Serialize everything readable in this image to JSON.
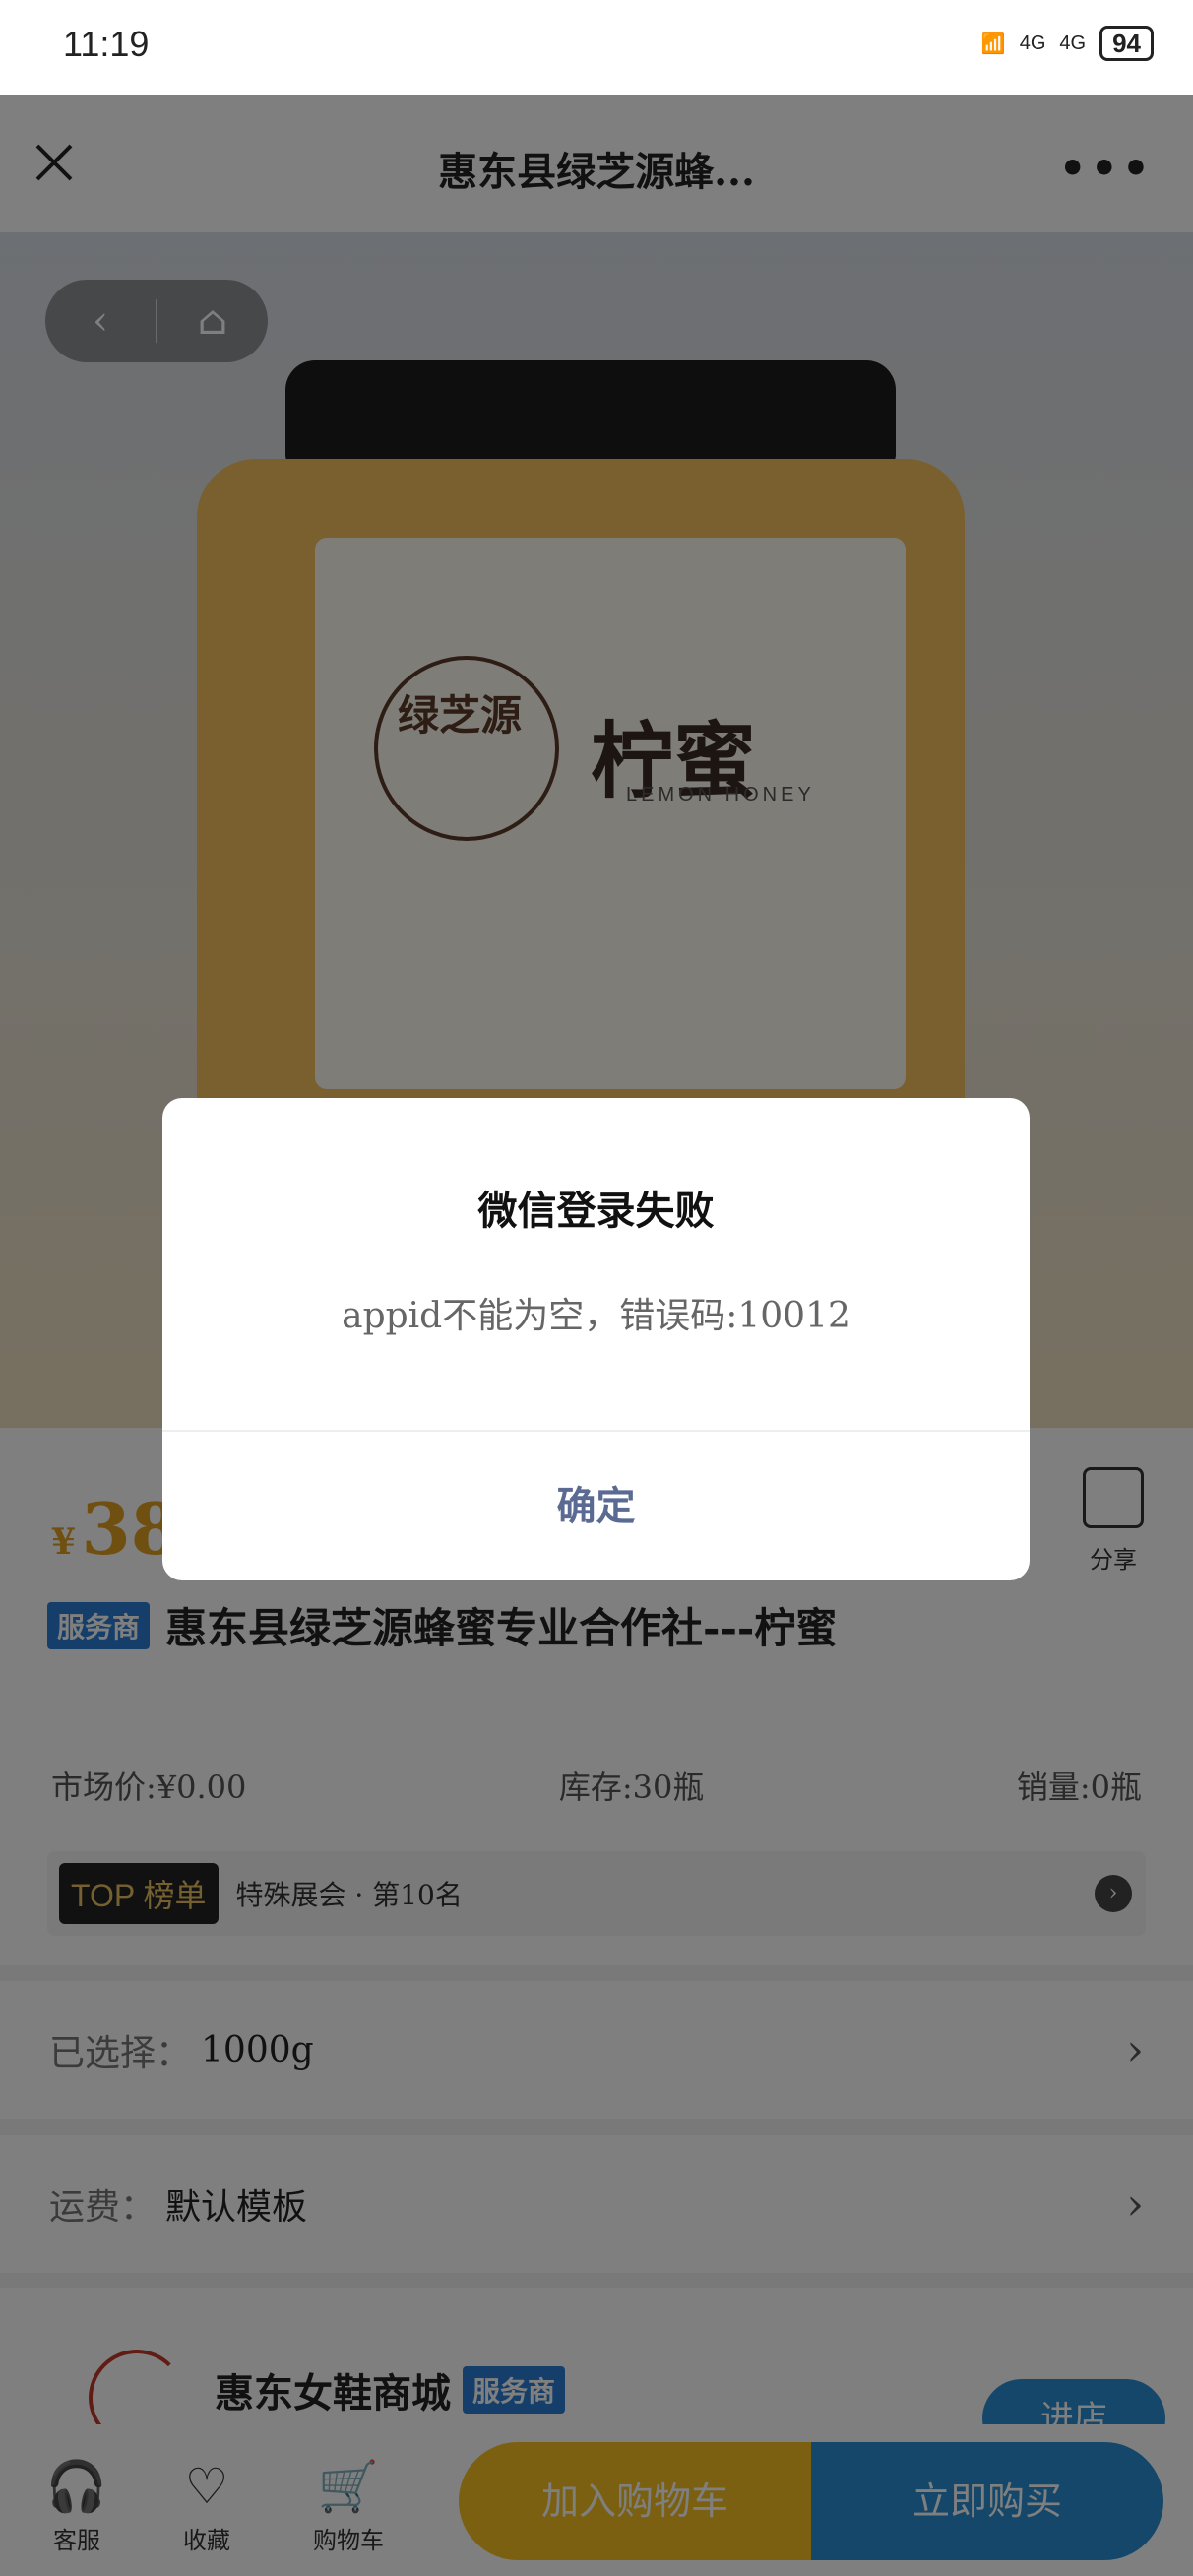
{
  "status_bar": {
    "time": "11:19",
    "net1": "4G",
    "net2": "4G",
    "battery": "94",
    "wifi": "6"
  },
  "nav": {
    "title": "惠东县绿芝源蜂...",
    "more": "•••"
  },
  "hero": {
    "label_cn": "柠蜜",
    "label_en": "LEMON HONEY",
    "logo_text": "绿芝源"
  },
  "product": {
    "price_symbol": "¥",
    "price": "38",
    "share_label": "分享",
    "tag": "服务商",
    "name": "惠东县绿芝源蜂蜜专业合作社---柠蜜",
    "market_price": "市场价:¥0.00",
    "stock": "库存:30瓶",
    "sales": "销量:0瓶",
    "top_badge_en": "TOP",
    "top_badge_cn": "榜单",
    "top_text": "特殊展会 · 第10名"
  },
  "options": {
    "selected_label": "已选择：",
    "selected_value": "1000g",
    "shipping_label": "运费：",
    "shipping_value": "默认模板"
  },
  "shop": {
    "name": "惠东女鞋商城",
    "tag": "服务商",
    "enter": "进店"
  },
  "bottom_bar": {
    "service": "客服",
    "favorite": "收藏",
    "cart": "购物车",
    "add_to_cart": "加入购物车",
    "buy_now": "立即购买"
  },
  "dialog": {
    "title": "微信登录失败",
    "message": "appid不能为空，错误码:10012",
    "confirm": "确定"
  }
}
